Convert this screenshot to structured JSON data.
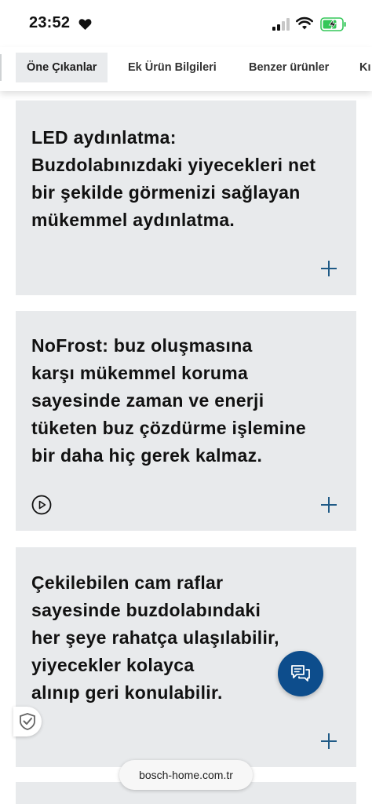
{
  "status_bar": {
    "time": "23:52"
  },
  "tabs": [
    {
      "label": "Öne Çıkanlar",
      "active": true
    },
    {
      "label": "Ek Ürün Bilgileri",
      "active": false
    },
    {
      "label": "Benzer ürünler",
      "active": false
    },
    {
      "label": "Kı",
      "active": false
    }
  ],
  "cards": [
    {
      "lines": [
        "LED aydınlatma:",
        "Buzdolabınızdaki yiyecekleri net",
        "bir şekilde görmenizi sağlayan",
        "mükemmel aydınlatma."
      ],
      "has_video": false
    },
    {
      "lines": [
        "NoFrost: buz oluşmasına",
        "karşı mükemmel koruma",
        "sayesinde zaman ve enerji",
        "tüketen buz çözdürme işlemine",
        "bir daha hiç gerek kalmaz."
      ],
      "has_video": true
    },
    {
      "lines": [
        "Çekilebilen cam raflar",
        "sayesinde buzdolabındaki",
        "her şeye rahatça ulaşılabilir,",
        "yiyecekler kolayca",
        "alınıp geri konulabilir."
      ],
      "has_video": false
    }
  ],
  "browser": {
    "url": "bosch-home.com.tr"
  },
  "icons": {
    "heart": "heart-icon",
    "signal": "cellular-signal-icon",
    "wifi": "wifi-icon",
    "battery": "battery-charging-icon",
    "expand": "plus-icon",
    "video": "play-icon",
    "chat": "chat-bubbles-icon",
    "trust": "trust-badge-check-icon"
  },
  "colors": {
    "card_bg": "#e8eaec",
    "accent_blue": "#0d4d8c",
    "plus_color": "#1f5a86",
    "battery_green": "#34c759"
  }
}
